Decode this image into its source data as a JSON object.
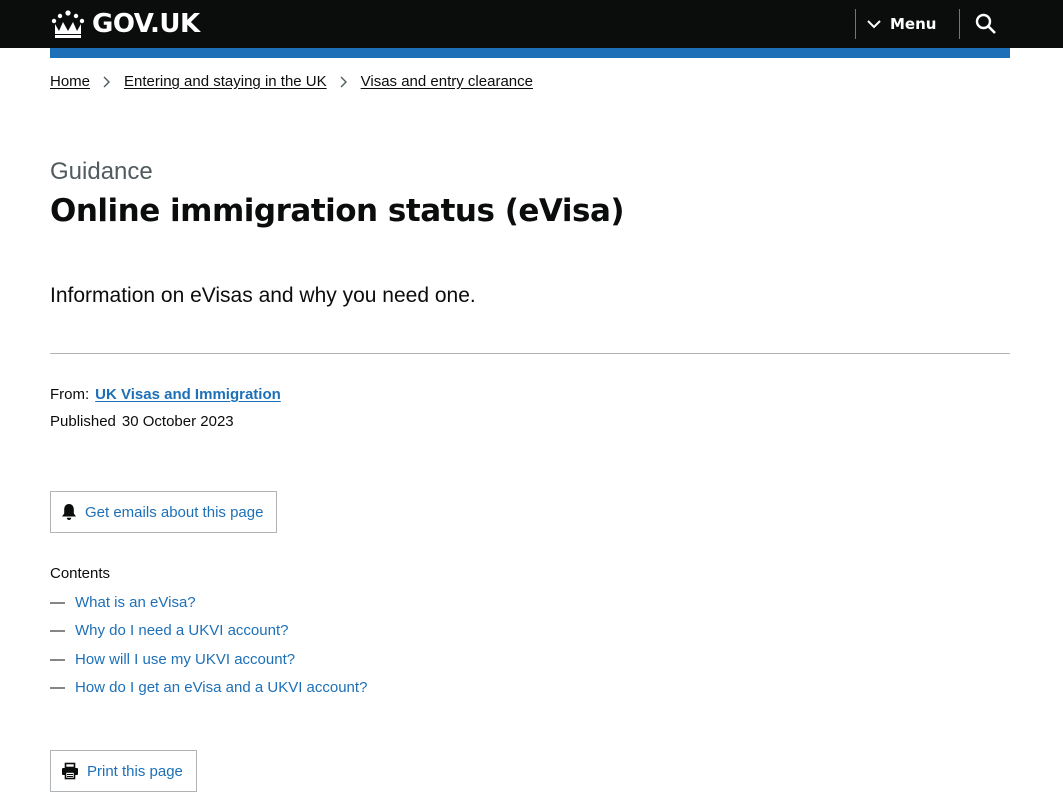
{
  "header": {
    "logo_text": "GOV.UK",
    "menu_label": "Menu",
    "search_icon": "search-icon"
  },
  "breadcrumbs": [
    {
      "label": "Home"
    },
    {
      "label": "Entering and staying in the UK"
    },
    {
      "label": "Visas and entry clearance"
    }
  ],
  "page": {
    "caption": "Guidance",
    "title": "Online immigration status (eVisa)",
    "lead": "Information on eVisas and why you need one."
  },
  "metadata": {
    "from_label": "From:",
    "from_org": "UK Visas and Immigration",
    "published_label": "Published",
    "published_date": "30 October 2023"
  },
  "actions": {
    "emails_label": "Get emails about this page",
    "print_label": "Print this page"
  },
  "contents": {
    "title": "Contents",
    "items": [
      {
        "dash": "—",
        "label": "What is an eVisa?"
      },
      {
        "dash": "—",
        "label": "Why do I need a UKVI account?"
      },
      {
        "dash": "—",
        "label": "How will I use my UKVI account?"
      },
      {
        "dash": "—",
        "label": "How do I get an eVisa and a UKVI account?"
      }
    ]
  },
  "colors": {
    "header_bg": "#0b0c0c",
    "brand_blue": "#1d70b8",
    "link": "#1d70b8",
    "secondary_text": "#505a5f",
    "border": "#b1b4b6"
  }
}
